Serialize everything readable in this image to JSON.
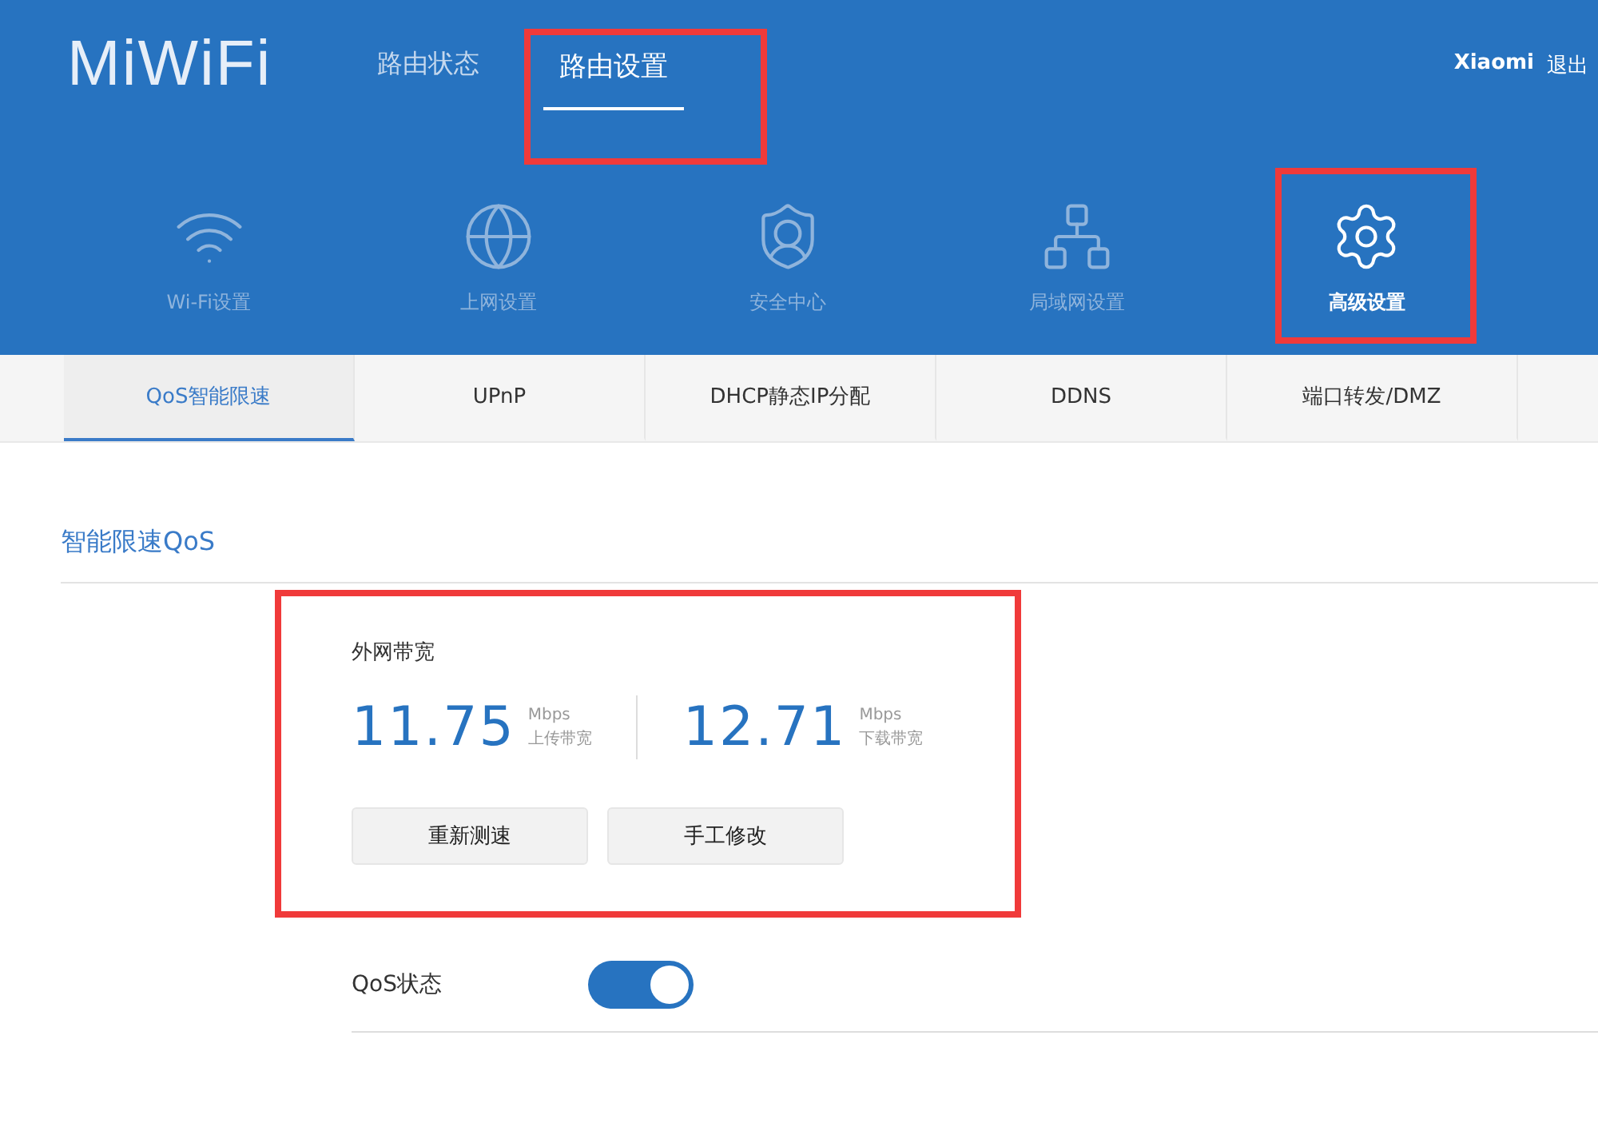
{
  "header": {
    "logo": "MiWiFi",
    "nav": [
      {
        "label": "路由状态",
        "selected": false,
        "highlighted": false
      },
      {
        "label": "路由设置",
        "selected": true,
        "highlighted": true
      }
    ],
    "user": "Xiaomi",
    "logout": "退出"
  },
  "categories": [
    {
      "kind": "wifi",
      "label": "Wi-Fi设置",
      "selected": false,
      "highlighted": false
    },
    {
      "kind": "internet",
      "label": "上网设置",
      "selected": false,
      "highlighted": false
    },
    {
      "kind": "security",
      "label": "安全中心",
      "selected": false,
      "highlighted": false
    },
    {
      "kind": "lan",
      "label": "局域网设置",
      "selected": false,
      "highlighted": false
    },
    {
      "kind": "advanced",
      "label": "高级设置",
      "selected": true,
      "highlighted": true
    }
  ],
  "tabs": [
    {
      "label": "QoS智能限速",
      "selected": true
    },
    {
      "label": "UPnP",
      "selected": false
    },
    {
      "label": "DHCP静态IP分配",
      "selected": false
    },
    {
      "label": "DDNS",
      "selected": false
    },
    {
      "label": "端口转发/DMZ",
      "selected": false
    }
  ],
  "section_title": "智能限速QoS",
  "bandwidth": {
    "title": "外网带宽",
    "highlighted": true,
    "readings": [
      {
        "value": "11.75",
        "unit": "Mbps",
        "label": "上传带宽"
      },
      {
        "value": "12.71",
        "unit": "Mbps",
        "label": "下载带宽"
      }
    ],
    "buttons": [
      "重新测速",
      "手工修改"
    ]
  },
  "qos": {
    "label": "QoS状态",
    "on": true
  }
}
